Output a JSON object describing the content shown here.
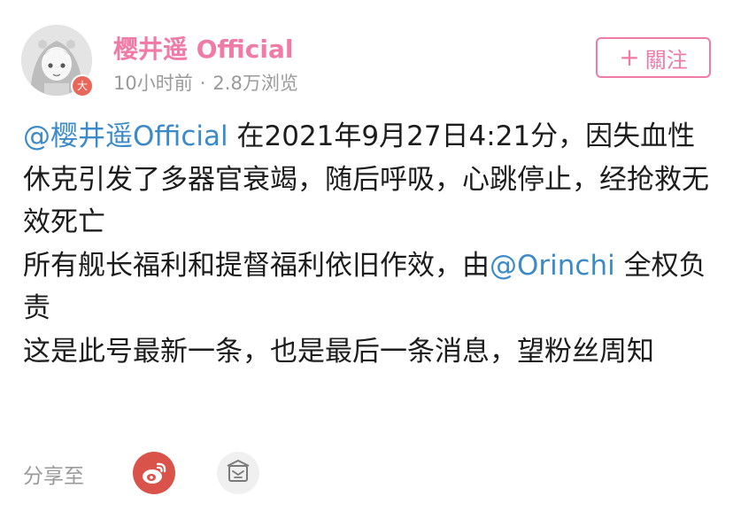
{
  "post": {
    "username": "樱井遥 Official",
    "avatar_badge": "大",
    "time": "10小时前",
    "separator": "·",
    "views": "2.8万浏览",
    "follow_label": "關注",
    "follow_plus": "+",
    "content": {
      "mention1": "@樱井遥Official",
      "text1": " 在2021年9月27日4:21分，因失血性休克引发了多器官衰竭，随后呼吸，心跳停止，经抢救无效死亡",
      "text2": "所有舰长福利和提督福利依旧作效，由",
      "mention2": "@Orinchi",
      "text3": " 全权负责",
      "text4": "这是此号最新一条，也是最后一条消息，望粉丝周知"
    }
  },
  "share": {
    "label": "分享至",
    "targets": [
      {
        "name": "weibo",
        "icon": "weibo-icon",
        "color": "#d9534a"
      },
      {
        "name": "qzone",
        "icon": "qzone-icon",
        "color": "#f0f0f0"
      }
    ]
  },
  "colors": {
    "accent": "#ef7ba6",
    "link": "#3c8bc8",
    "muted": "#9a9a9a",
    "text": "#1c1c1c"
  }
}
